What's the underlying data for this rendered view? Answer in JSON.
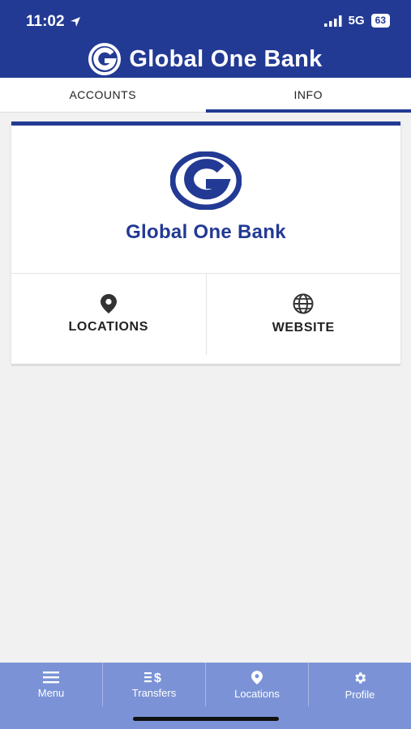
{
  "status_bar": {
    "time": "11:02",
    "network": "5G",
    "battery": "63"
  },
  "header": {
    "brand": "Global One Bank"
  },
  "tabs": [
    {
      "label": "ACCOUNTS",
      "active": false
    },
    {
      "label": "INFO",
      "active": true
    }
  ],
  "info_card": {
    "brand": "Global One Bank",
    "actions": [
      {
        "label": "LOCATIONS",
        "icon": "map-pin-icon"
      },
      {
        "label": "WEBSITE",
        "icon": "globe-icon"
      }
    ]
  },
  "bottom_nav": [
    {
      "label": "Menu",
      "icon": "menu-icon"
    },
    {
      "label": "Transfers",
      "icon": "transfers-icon"
    },
    {
      "label": "Locations",
      "icon": "map-pin-icon"
    },
    {
      "label": "Profile",
      "icon": "gear-icon"
    }
  ],
  "colors": {
    "brand_blue": "#233a94",
    "nav_blue": "#7b93d6"
  }
}
